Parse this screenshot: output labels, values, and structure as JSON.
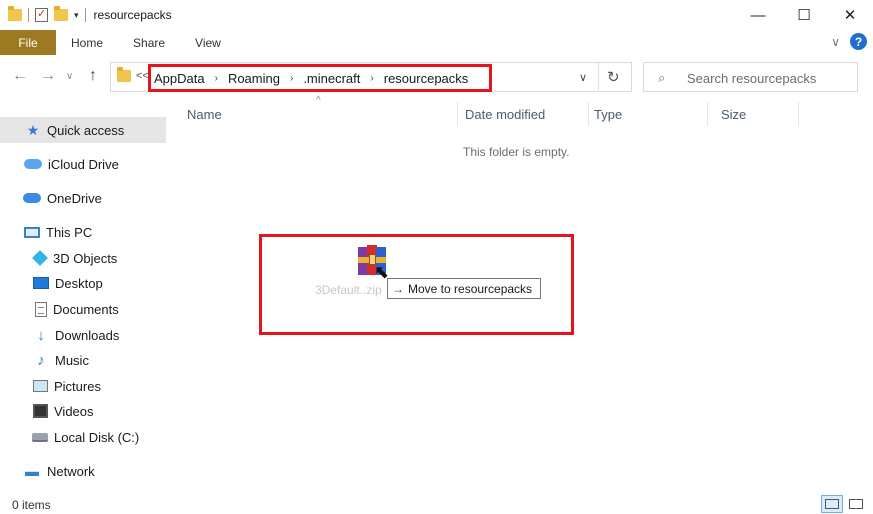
{
  "window": {
    "title": "resourcepacks",
    "minimize_glyph": "—",
    "maximize_glyph": "☐",
    "close_glyph": "✕"
  },
  "ribbon": {
    "tabs": [
      {
        "label": "File"
      },
      {
        "label": "Home"
      },
      {
        "label": "Share"
      },
      {
        "label": "View"
      }
    ],
    "expand_glyph": "∨",
    "help_glyph": "?"
  },
  "nav": {
    "back_glyph": "←",
    "forward_glyph": "→",
    "recent_glyph": "∨",
    "up_glyph": "↑"
  },
  "address": {
    "overflow": "<<",
    "crumbs": [
      "AppData",
      "Roaming",
      ".minecraft",
      "resourcepacks"
    ],
    "separator": "›",
    "dropdown_glyph": "∨",
    "refresh_glyph": "↻"
  },
  "search": {
    "placeholder": "Search resourcepacks",
    "icon_glyph": "⌕"
  },
  "sidebar": {
    "items": [
      {
        "label": "Quick access",
        "icon": "star-icon"
      },
      {
        "label": "iCloud Drive",
        "icon": "cloud-icon"
      },
      {
        "label": "OneDrive",
        "icon": "onedrive-icon"
      },
      {
        "label": "This PC",
        "icon": "pc-icon"
      },
      {
        "label": "3D Objects",
        "icon": "cube-icon"
      },
      {
        "label": "Desktop",
        "icon": "desktop-icon"
      },
      {
        "label": "Documents",
        "icon": "document-icon"
      },
      {
        "label": "Downloads",
        "icon": "download-icon"
      },
      {
        "label": "Music",
        "icon": "music-icon"
      },
      {
        "label": "Pictures",
        "icon": "pictures-icon"
      },
      {
        "label": "Videos",
        "icon": "videos-icon"
      },
      {
        "label": "Local Disk (C:)",
        "icon": "disk-icon"
      },
      {
        "label": "Network",
        "icon": "network-icon"
      }
    ]
  },
  "columns": {
    "name": "Name",
    "date": "Date modified",
    "type": "Type",
    "size": "Size",
    "sort_glyph": "^"
  },
  "content": {
    "empty_message": "This folder is empty."
  },
  "drag": {
    "file_label": "3Default..zip",
    "tooltip_arrow": "→",
    "tooltip_text": "Move to resourcepacks"
  },
  "status": {
    "items": "0 items"
  },
  "colors": {
    "file_tab": "#9d7a22",
    "highlight_box": "#e8141c",
    "selection": "#e5e5e5",
    "accent": "#1f6fcc"
  }
}
